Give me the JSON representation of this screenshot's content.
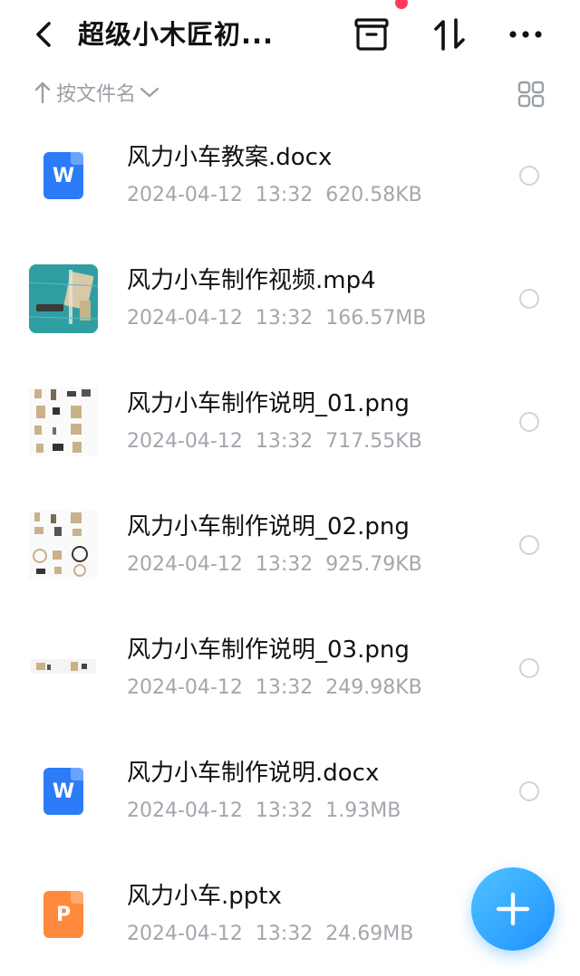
{
  "header": {
    "title": "超级小木匠初...",
    "notification_dot_color": "#ff3a5c"
  },
  "sortbar": {
    "label": "按文件名"
  },
  "files": [
    {
      "name": "风力小车教案.docx",
      "date": "2024-04-12",
      "time": "13:32",
      "size": "620.58KB",
      "icon": "word-doc-icon"
    },
    {
      "name": "风力小车制作视频.mp4",
      "date": "2024-04-12",
      "time": "13:32",
      "size": "166.57MB",
      "icon": "video-thumbnail"
    },
    {
      "name": "风力小车制作说明_01.png",
      "date": "2024-04-12",
      "time": "13:32",
      "size": "717.55KB",
      "icon": "image-thumbnail"
    },
    {
      "name": "风力小车制作说明_02.png",
      "date": "2024-04-12",
      "time": "13:32",
      "size": "925.79KB",
      "icon": "image-thumbnail"
    },
    {
      "name": "风力小车制作说明_03.png",
      "date": "2024-04-12",
      "time": "13:32",
      "size": "249.98KB",
      "icon": "image-thumbnail"
    },
    {
      "name": "风力小车制作说明.docx",
      "date": "2024-04-12",
      "time": "13:32",
      "size": "1.93MB",
      "icon": "word-doc-icon"
    },
    {
      "name": "风力小车.pptx",
      "date": "2024-04-12",
      "time": "13:32",
      "size": "24.69MB",
      "icon": "ppt-doc-icon"
    }
  ],
  "colors": {
    "word": "#2b7cf6",
    "ppt": "#ff8a3d",
    "fab": "#1e90ff"
  }
}
